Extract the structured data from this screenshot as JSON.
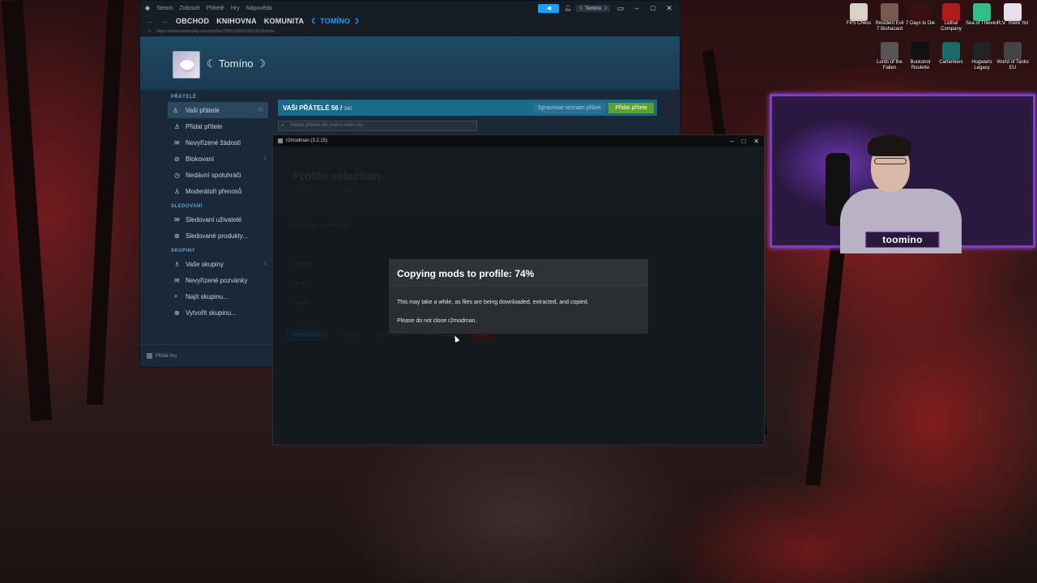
{
  "steam": {
    "titlebar_menu": [
      "Steam",
      "Zobrazit",
      "Přátelé",
      "Hry",
      "Nápověda"
    ],
    "user_chip": "☾ Tomíno ☽",
    "nav_tabs": [
      "OBCHOD",
      "KNIHOVNA",
      "KOMUNITA",
      "☾ TOMÍNO ☽"
    ],
    "url": "https://steamcommunity.com/profiles/76561199062931051/friends",
    "profile_name": "☾ Tomíno ☽",
    "sections": {
      "friends": "PŘÁTELÉ",
      "following": "SLEDOVANÍ",
      "groups": "SKUPINY"
    },
    "friends_items": [
      {
        "label": "Vaši přátelé",
        "count": "56"
      },
      {
        "label": "Přidat přítele",
        "count": ""
      },
      {
        "label": "Nevyřízené žádosti",
        "count": ""
      },
      {
        "label": "Blokovaní",
        "count": "1"
      },
      {
        "label": "Nedávní spoluhráči",
        "count": ""
      },
      {
        "label": "Moderátoři přenosů",
        "count": ""
      }
    ],
    "following_items": [
      {
        "label": "Sledovaní uživatelé"
      },
      {
        "label": "Sledované produkty..."
      }
    ],
    "groups_items": [
      {
        "label": "Vaše skupiny",
        "count": "1"
      },
      {
        "label": "Nevyřízené pozvánky"
      },
      {
        "label": "Najít skupinu..."
      },
      {
        "label": "Vytvořit skupinu..."
      }
    ],
    "footer": "Přidat hru",
    "friends_bar": {
      "title": "VAŠI PŘÁTELÉ",
      "count": "56",
      "max": "340",
      "manage_button": "Spravovat seznam přátel",
      "add_button": "Přidat přítele"
    },
    "search_placeholder": "Hledat přátele dle jména nebo hry"
  },
  "r2modman": {
    "window_title": "r2modman (3.2.15)",
    "hero_title": "Profile selection",
    "hero_subtitle": "Profiles help to organize mods easily",
    "back": "Back to game selection",
    "profiles": [
      "Default",
      "Lena",
      "stream"
    ],
    "buttons": [
      "Select profile",
      "Rename",
      "Create new",
      "Import / Update",
      "Delete"
    ],
    "modal": {
      "title": "Copying mods to profile: 74%",
      "progress_percent": 74,
      "line1": "This may take a while, as files are being downloaded, extracted, and copied.",
      "line2": "Please do not close r2modman."
    }
  },
  "desktop_icons": [
    {
      "label": "FPS Chess"
    },
    {
      "label": "Resident Evil 7 Biohazard"
    },
    {
      "label": "7 Days to Die"
    },
    {
      "label": "Lethal Company"
    },
    {
      "label": "Sea of Thieves"
    },
    {
      "label": "R.V. There Yet"
    },
    {
      "label": "Lords of the Fallen"
    },
    {
      "label": "Buckshot Roulette"
    },
    {
      "label": "Cartenkers"
    },
    {
      "label": "Hogwarts Legacy"
    },
    {
      "label": "World of Tanks EU"
    }
  ],
  "webcam": {
    "name": "toomino"
  }
}
